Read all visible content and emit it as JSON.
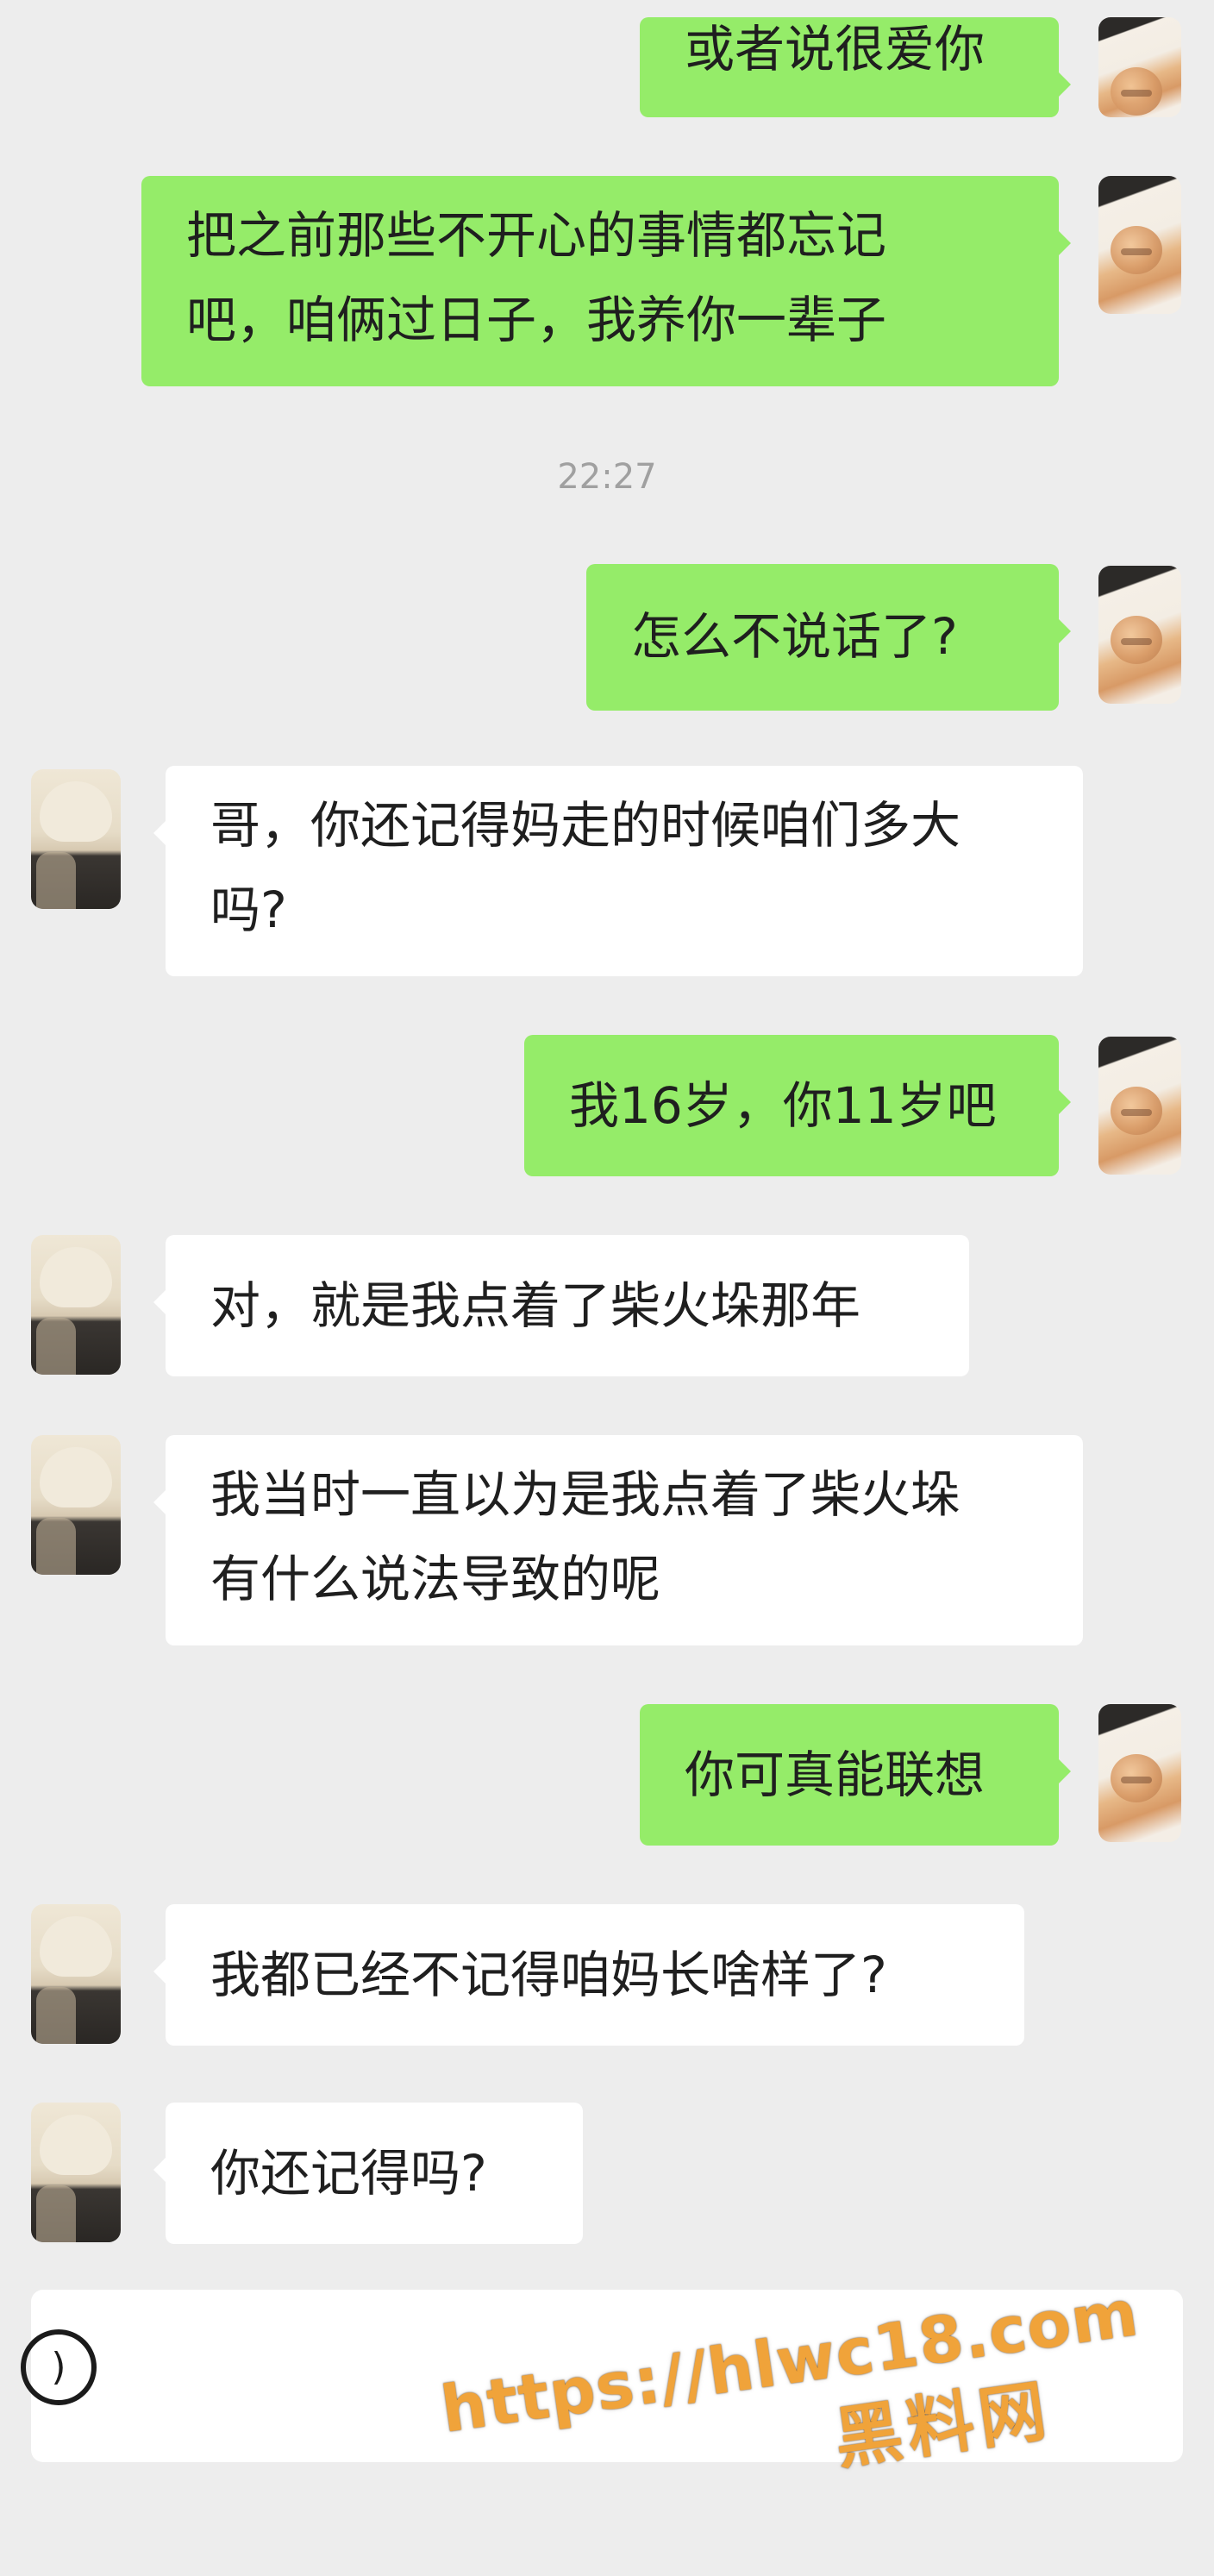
{
  "messages": [
    {
      "id": "m1",
      "from": "me",
      "lines": [
        "或者说很爱你"
      ]
    },
    {
      "id": "m2",
      "from": "me",
      "lines": [
        "把之前那些不开心的事情都忘记",
        "吧，咱俩过日子，我养你一辈子"
      ]
    },
    {
      "id": "t1",
      "type": "timestamp",
      "text": "22:27"
    },
    {
      "id": "m3",
      "from": "me",
      "lines": [
        "怎么不说话了?"
      ]
    },
    {
      "id": "m4",
      "from": "other",
      "lines": [
        "哥，你还记得妈走的时候咱们多大",
        "吗?"
      ]
    },
    {
      "id": "m5",
      "from": "me",
      "lines": [
        "我16岁，你11岁吧"
      ]
    },
    {
      "id": "m6",
      "from": "other",
      "lines": [
        "对，就是我点着了柴火垛那年"
      ]
    },
    {
      "id": "m7",
      "from": "other",
      "lines": [
        "我当时一直以为是我点着了柴火垛",
        "有什么说法导致的呢"
      ]
    },
    {
      "id": "m8",
      "from": "me",
      "lines": [
        "你可真能联想"
      ]
    },
    {
      "id": "m9",
      "from": "other",
      "lines": [
        "我都已经不记得咱妈长啥样了?"
      ]
    },
    {
      "id": "m10",
      "from": "other",
      "lines": [
        "你还记得吗?"
      ]
    }
  ],
  "input_bar": {
    "voice_icon": "voice-icon",
    "voice_glyph": ")"
  },
  "watermark": {
    "url": "https://hlwc18.com",
    "site": "黑料网"
  }
}
